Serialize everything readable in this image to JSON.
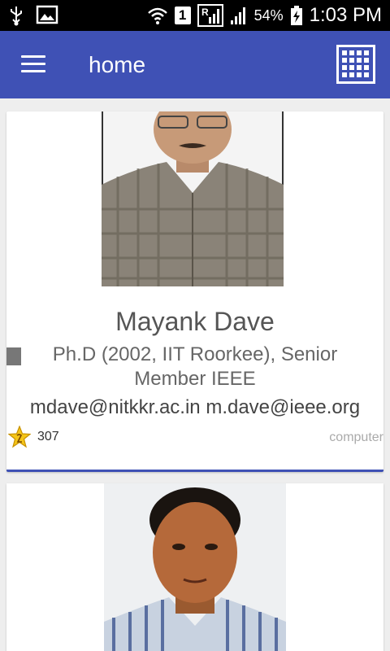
{
  "statusbar": {
    "sim": "1",
    "battery": "54%",
    "time": "1:03 PM",
    "icons": [
      "usb-icon",
      "image-icon",
      "wifi-icon",
      "sim-icon",
      "signal-roaming-icon",
      "signal-icon",
      "battery-charging-icon"
    ]
  },
  "appbar": {
    "title": "home",
    "accent": "#3f51b5",
    "menu_icon": "hamburger-menu-icon",
    "grid_icon": "grid-view-icon"
  },
  "cards": [
    {
      "name": "Mayank Dave",
      "description": "Ph.D (2002, IIT Roorkee), Senior Member IEEE",
      "emails": "mdave@nitkkr.ac.in m.dave@ieee.org",
      "rating_count": "307",
      "department": "computer"
    }
  ]
}
